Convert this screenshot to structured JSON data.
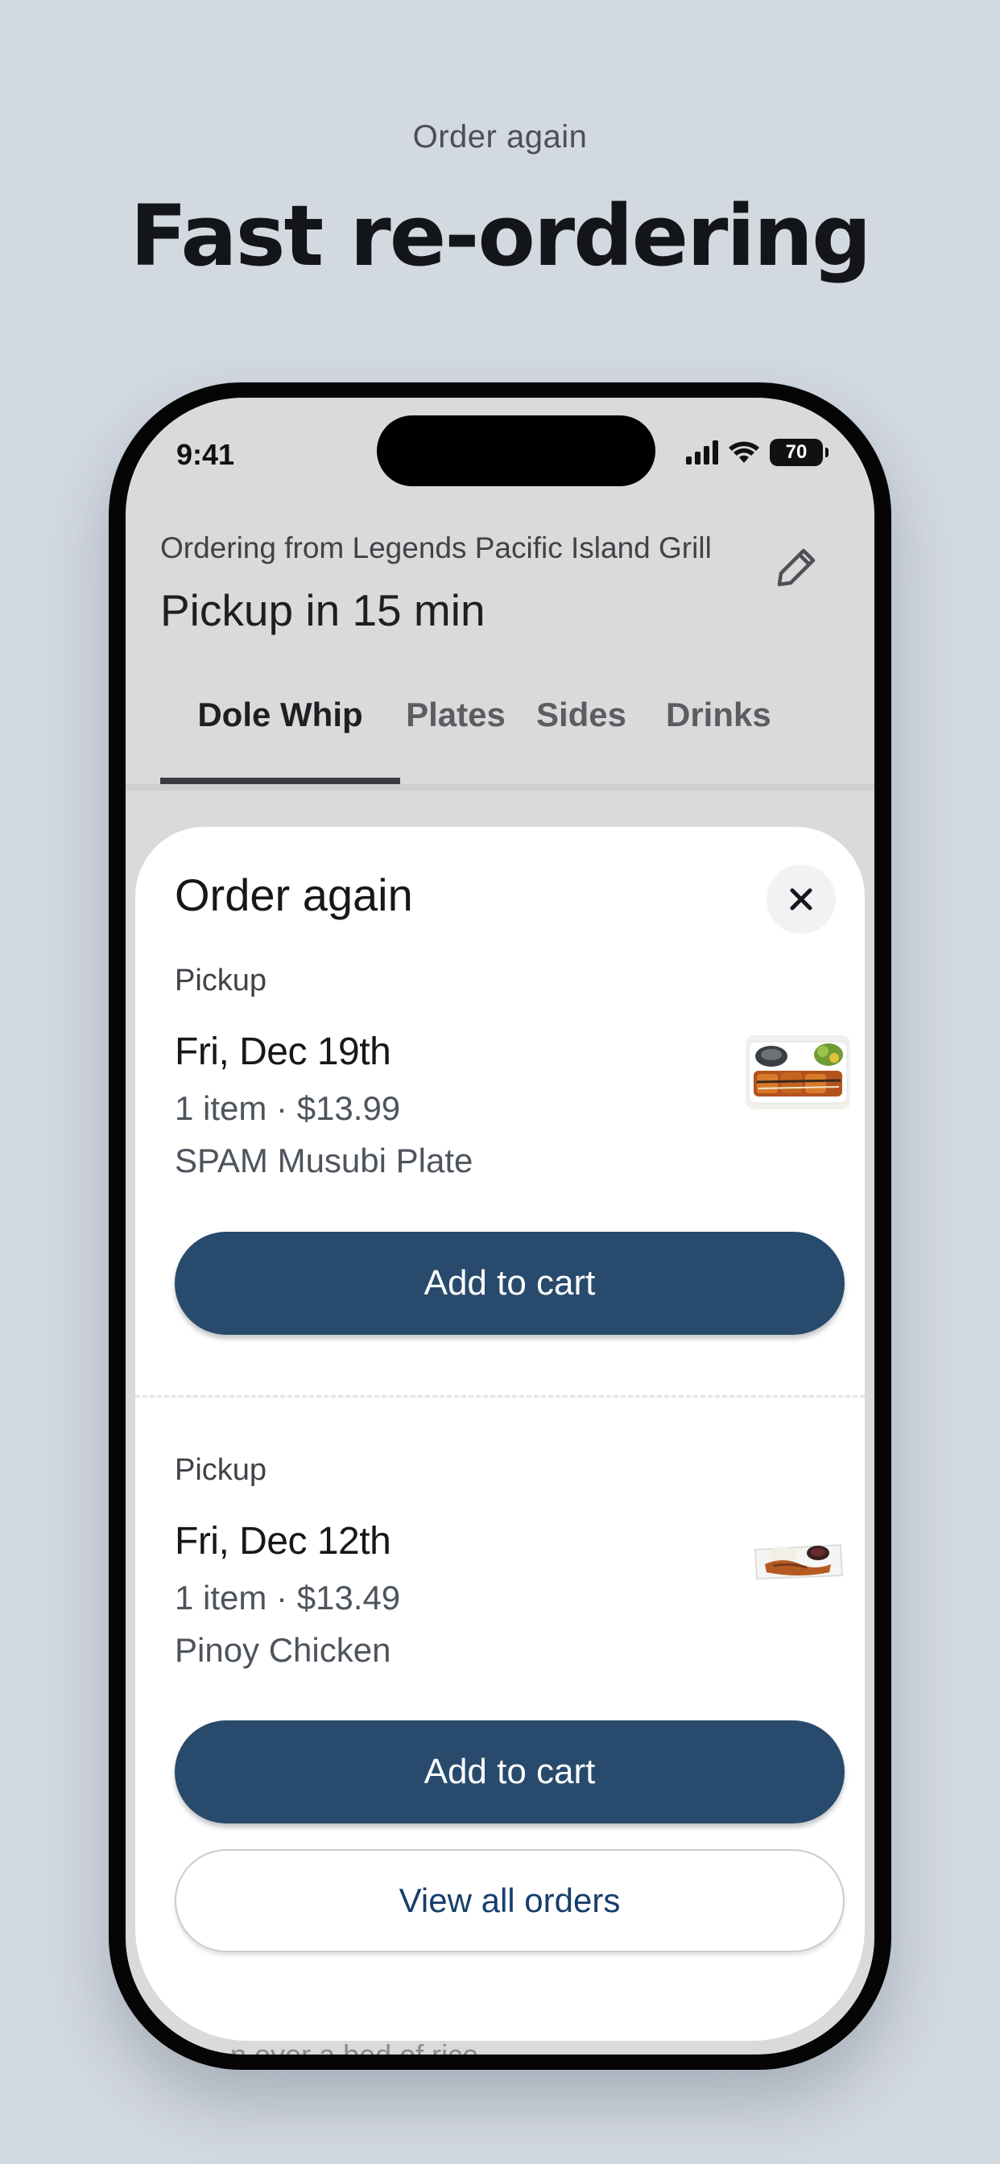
{
  "promo": {
    "eyebrow": "Order again",
    "title": "Fast re-ordering"
  },
  "status_bar": {
    "time": "9:41",
    "battery": "70"
  },
  "header": {
    "ordering_from": "Ordering from Legends Pacific Island Grill",
    "pickup_time": "Pickup in 15 min"
  },
  "tabs": [
    {
      "label": "Dole Whip",
      "active": true
    },
    {
      "label": "Plates",
      "active": false
    },
    {
      "label": "Sides",
      "active": false
    },
    {
      "label": "Drinks",
      "active": false
    }
  ],
  "background_text": "...n over a bed of rice",
  "sheet": {
    "title": "Order again",
    "orders": [
      {
        "type": "Pickup",
        "date": "Fri, Dec 19th",
        "summary": "1 item · $13.99",
        "item": "SPAM Musubi Plate",
        "button": "Add to cart"
      },
      {
        "type": "Pickup",
        "date": "Fri, Dec 12th",
        "summary": "1 item · $13.49",
        "item": "Pinoy Chicken",
        "button": "Add to cart"
      }
    ],
    "view_all": "View all orders"
  },
  "colors": {
    "background": "#d3d9e1",
    "primary_button": "#284a6c",
    "link_text": "#173e6b"
  }
}
